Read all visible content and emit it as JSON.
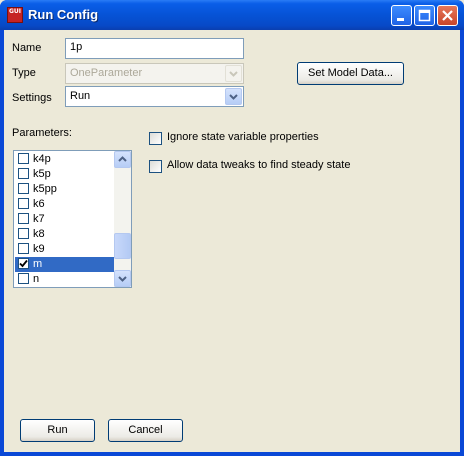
{
  "window": {
    "title": "Run Config",
    "app_icon_label": "GUI",
    "app_icon": "app-logo-icon",
    "controls": [
      "minimize-icon",
      "maximize-icon",
      "close-icon"
    ]
  },
  "form": {
    "name_label": "Name",
    "name_value": "1p",
    "type_label": "Type",
    "type_value": "OneParameter",
    "type_enabled": false,
    "settings_label": "Settings",
    "settings_value": "Run",
    "set_model_data_button": "Set Model Data..."
  },
  "parameters": {
    "label": "Parameters:",
    "items": [
      {
        "name": "k4p",
        "checked": false,
        "selected": false
      },
      {
        "name": "k5p",
        "checked": false,
        "selected": false
      },
      {
        "name": "k5pp",
        "checked": false,
        "selected": false
      },
      {
        "name": "k6",
        "checked": false,
        "selected": false
      },
      {
        "name": "k7",
        "checked": false,
        "selected": false
      },
      {
        "name": "k8",
        "checked": false,
        "selected": false
      },
      {
        "name": "k9",
        "checked": false,
        "selected": false
      },
      {
        "name": "m",
        "checked": true,
        "selected": true
      },
      {
        "name": "n",
        "checked": false,
        "selected": false
      }
    ],
    "scroll_position": 0.85
  },
  "options": {
    "ignore_state_label": "Ignore state variable properties",
    "ignore_state_checked": false,
    "allow_tweaks_label": "Allow data tweaks to find steady state",
    "allow_tweaks_checked": false
  },
  "buttons": {
    "run": "Run",
    "cancel": "Cancel"
  },
  "colors": {
    "titlebar": "#0653d6",
    "selection": "#316ac5",
    "dialog_background": "#ece9d8"
  }
}
